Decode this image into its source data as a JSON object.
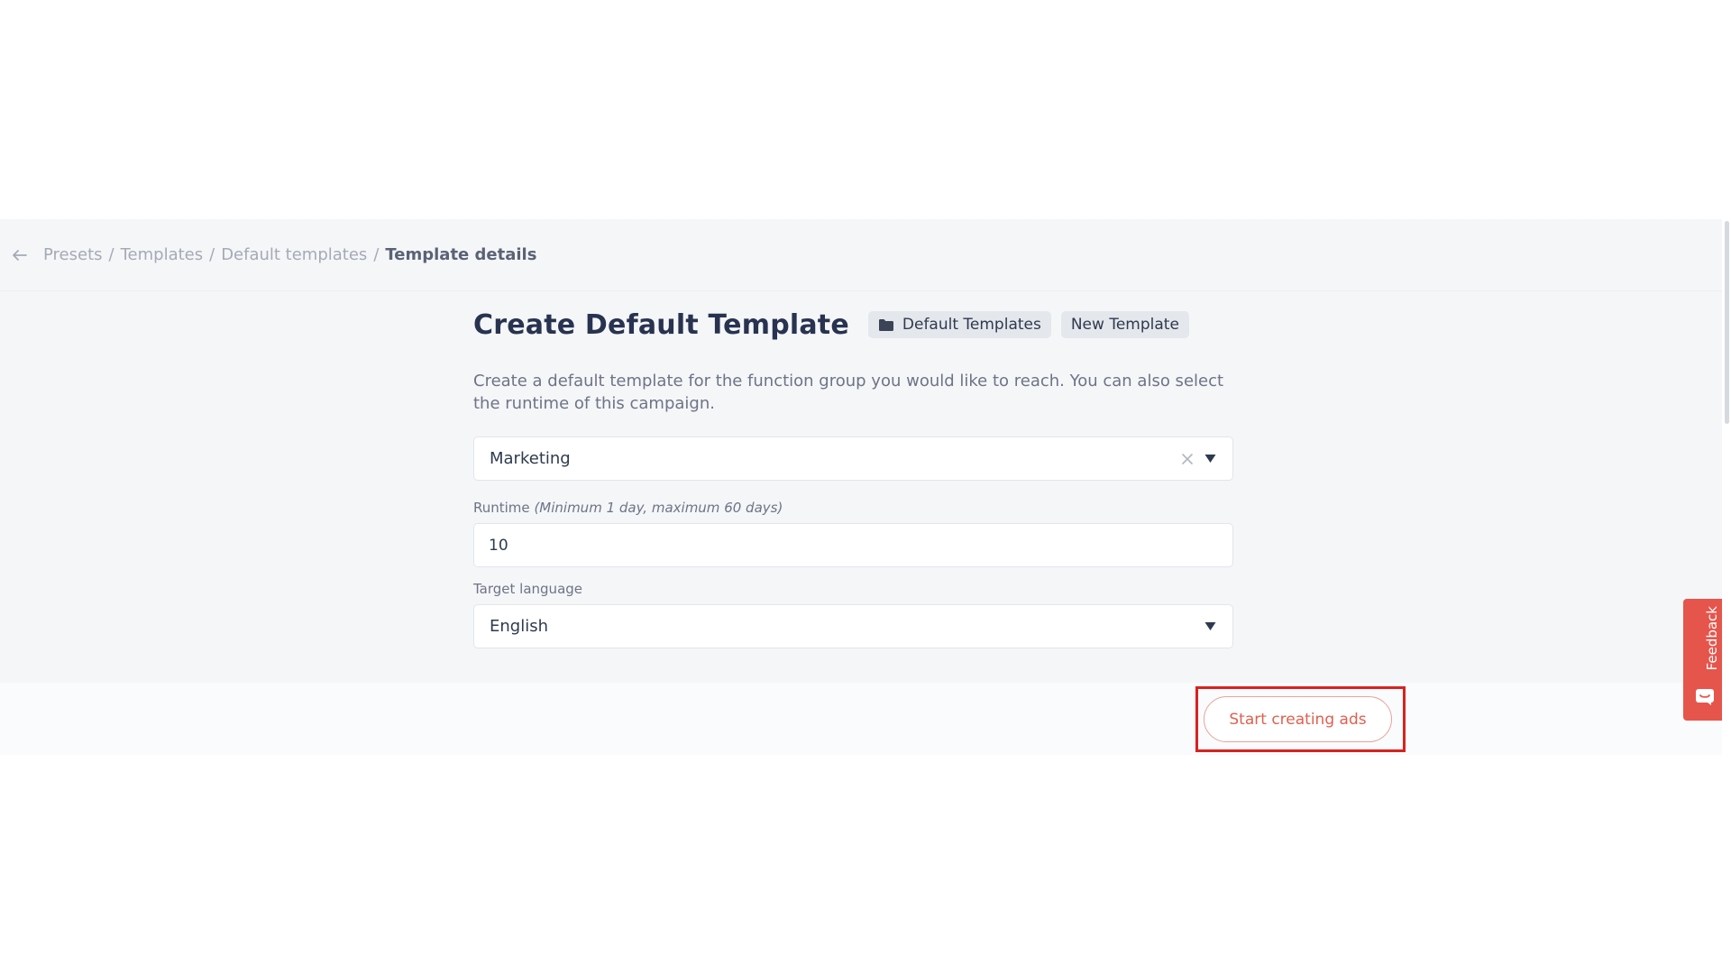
{
  "breadcrumb": {
    "items": [
      "Presets",
      "Templates",
      "Default templates"
    ],
    "separator": "/",
    "current": "Template details"
  },
  "header": {
    "title": "Create Default Template",
    "chips": [
      {
        "label": "Default Templates",
        "icon": "folder-icon"
      },
      {
        "label": "New Template"
      }
    ]
  },
  "description": "Create a default template for the function group you would like to reach. You can also select the runtime of this campaign.",
  "form": {
    "function_group": {
      "value": "Marketing"
    },
    "runtime": {
      "label": "Runtime",
      "hint": "(Minimum 1 day, maximum 60 days)",
      "value": "10"
    },
    "target_language": {
      "label": "Target language",
      "value": "English"
    }
  },
  "footer": {
    "start_button_label": "Start creating ads"
  },
  "feedback": {
    "label": "Feedback"
  },
  "colors": {
    "accent": "#e0604e",
    "highlight": "#d9221f",
    "feedback_bg": "#e6554b"
  }
}
